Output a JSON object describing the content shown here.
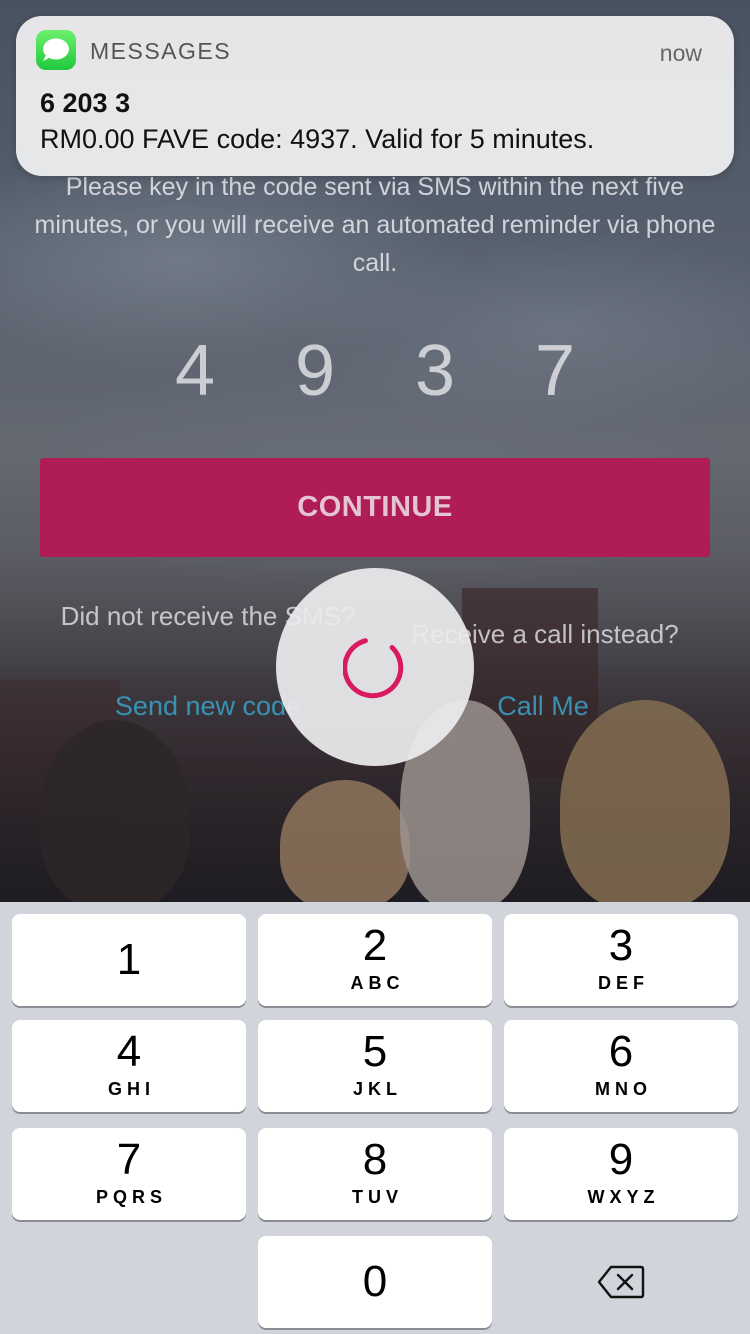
{
  "notification": {
    "app_name": "MESSAGES",
    "time": "now",
    "sender": "6 203 3",
    "body": "RM0.00 FAVE code: 4937. Valid for 5 minutes.",
    "icon": "messages-app-icon"
  },
  "verification": {
    "instructions": "Please key in the code sent via SMS within the next five minutes, or you will receive an automated reminder via phone call.",
    "code_digits": [
      "4",
      "9",
      "3",
      "7"
    ],
    "continue_label": "CONTINUE",
    "no_sms_text": "Did not receive the SMS?",
    "send_new_code_label": "Send new code",
    "call_instead_text": "Receive a call instead?",
    "call_me_label": "Call Me"
  },
  "spinner": {
    "icon": "loading-spinner-icon",
    "accent": "#d81b60"
  },
  "colors": {
    "continue_bg": "#b01c56",
    "link": "#3ba3c9",
    "keypad_bg": "#d1d4da"
  },
  "keypad": {
    "keys": [
      {
        "num": "1",
        "letters": ""
      },
      {
        "num": "2",
        "letters": "ABC"
      },
      {
        "num": "3",
        "letters": "DEF"
      },
      {
        "num": "4",
        "letters": "GHI"
      },
      {
        "num": "5",
        "letters": "JKL"
      },
      {
        "num": "6",
        "letters": "MNO"
      },
      {
        "num": "7",
        "letters": "PQRS"
      },
      {
        "num": "8",
        "letters": "TUV"
      },
      {
        "num": "9",
        "letters": "WXYZ"
      },
      {
        "num": "0",
        "letters": ""
      }
    ],
    "backspace_icon": "backspace-icon"
  }
}
